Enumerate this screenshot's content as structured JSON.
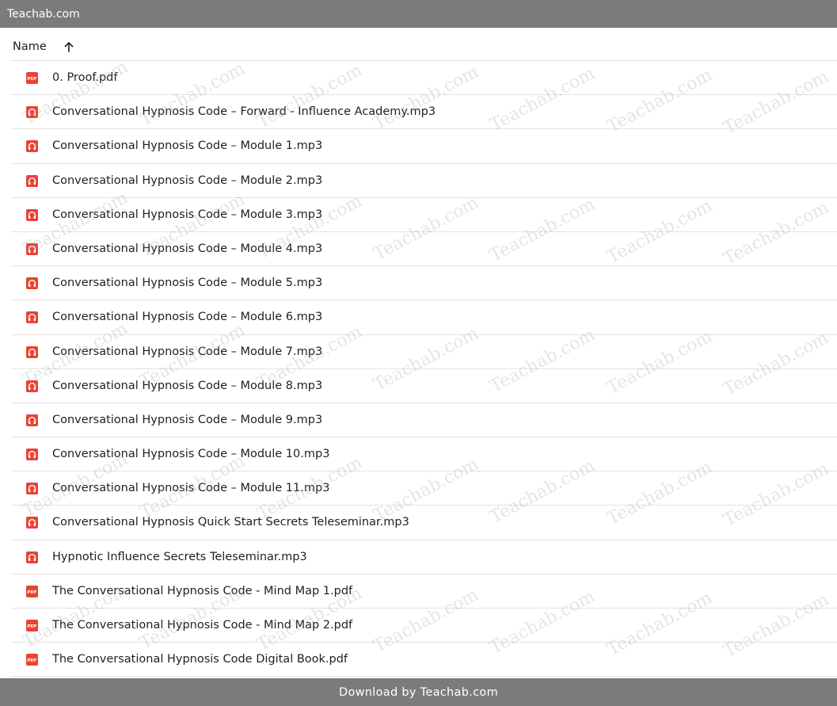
{
  "window": {
    "title": "Teachab.com"
  },
  "header": {
    "name_label": "Name"
  },
  "files": [
    {
      "name": "0. Proof.pdf",
      "type": "pdf"
    },
    {
      "name": "Conversational Hypnosis Code – Forward - Influence Academy.mp3",
      "type": "audio"
    },
    {
      "name": "Conversational Hypnosis Code – Module 1.mp3",
      "type": "audio"
    },
    {
      "name": "Conversational Hypnosis Code – Module 2.mp3",
      "type": "audio"
    },
    {
      "name": "Conversational Hypnosis Code – Module 3.mp3",
      "type": "audio"
    },
    {
      "name": "Conversational Hypnosis Code – Module 4.mp3",
      "type": "audio"
    },
    {
      "name": "Conversational Hypnosis Code – Module 5.mp3",
      "type": "audio"
    },
    {
      "name": "Conversational Hypnosis Code – Module 6.mp3",
      "type": "audio"
    },
    {
      "name": "Conversational Hypnosis Code – Module 7.mp3",
      "type": "audio"
    },
    {
      "name": "Conversational Hypnosis Code – Module 8.mp3",
      "type": "audio"
    },
    {
      "name": "Conversational Hypnosis Code – Module 9.mp3",
      "type": "audio"
    },
    {
      "name": "Conversational Hypnosis Code – Module 10.mp3",
      "type": "audio"
    },
    {
      "name": "Conversational Hypnosis Code – Module 11.mp3",
      "type": "audio"
    },
    {
      "name": "Conversational Hypnosis Quick Start Secrets Teleseminar.mp3",
      "type": "audio"
    },
    {
      "name": "Hypnotic Influence Secrets Teleseminar.mp3",
      "type": "audio"
    },
    {
      "name": "The Conversational Hypnosis Code - Mind Map 1.pdf",
      "type": "pdf"
    },
    {
      "name": "The Conversational Hypnosis Code - Mind Map 2.pdf",
      "type": "pdf"
    },
    {
      "name": "The Conversational Hypnosis Code Digital Book.pdf",
      "type": "pdf"
    }
  ],
  "icons": {
    "pdf": "pdf-icon",
    "audio": "audio-file-icon",
    "sort": "arrow-up-icon",
    "pdf_badge_text": "PDF"
  },
  "footer": {
    "text": "Download by Teachab.com"
  },
  "watermark": {
    "text": "Teachab.com"
  },
  "colors": {
    "bar_background": "#7b7b7b",
    "icon_red": "#ea4335",
    "divider": "#e3e3e3",
    "text": "#1f1f1f"
  }
}
